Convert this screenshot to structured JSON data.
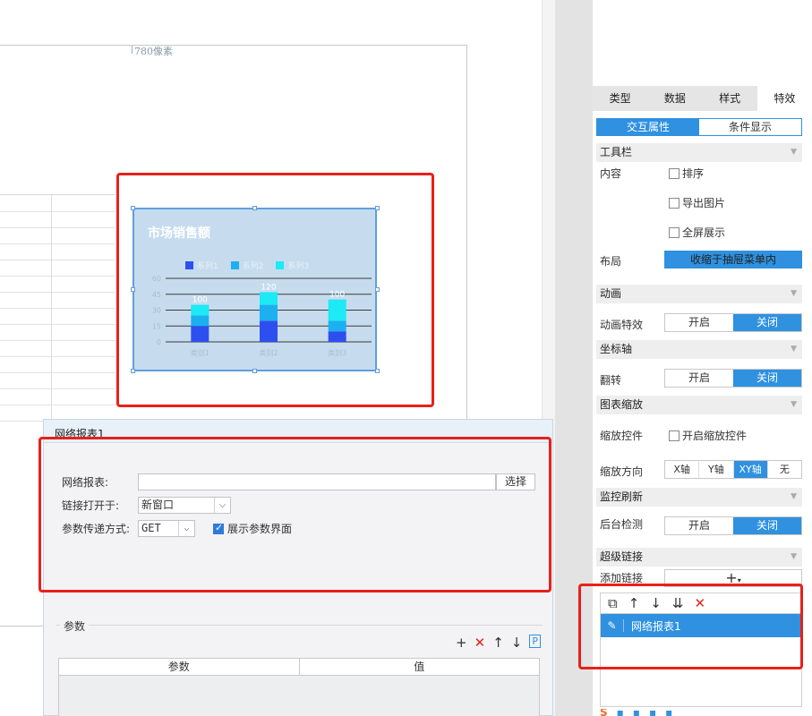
{
  "canvas": {
    "ruler_label": "780像素",
    "chart": {
      "title": "市场销售额",
      "legend": [
        {
          "label": "系列1",
          "color": "#2e4ff0"
        },
        {
          "label": "系列2",
          "color": "#1cb0f0"
        },
        {
          "label": "系列3",
          "color": "#1ceaf5"
        }
      ],
      "bars": [
        {
          "category": "类别1",
          "total_label": "100",
          "stack": [
            15,
            10,
            10
          ]
        },
        {
          "category": "类别2",
          "total_label": "120",
          "stack": [
            20,
            15,
            12
          ]
        },
        {
          "category": "类别3",
          "total_label": "100",
          "stack": [
            10,
            10,
            20
          ]
        }
      ],
      "ylim": [
        0,
        60
      ],
      "y_ticks": [
        "0",
        "15",
        "30",
        "45",
        "60"
      ]
    }
  },
  "dialog": {
    "title": "网络报表1",
    "report_label": "网络报表:",
    "report_value": "",
    "select_button": "选择",
    "open_in_label": "链接打开于:",
    "open_in_value": "新窗口",
    "method_label": "参数传递方式:",
    "method_value": "GET",
    "show_params_label": "展示参数界面",
    "show_params_checked": true,
    "params": {
      "title": "参数",
      "col_param": "参数",
      "col_value": "值"
    }
  },
  "panel": {
    "tabs": [
      "类型",
      "数据",
      "样式",
      "特效"
    ],
    "active_tab": "特效",
    "subtabs": [
      "交互属性",
      "条件显示"
    ],
    "sections": {
      "toolbar": "工具栏",
      "animation": "动画",
      "axis": "坐标轴",
      "zoom": "图表缩放",
      "monitor": "监控刷新",
      "hyperlink": "超级链接"
    },
    "content_label": "内容",
    "content_options": [
      "排序",
      "导出图片",
      "全屏展示"
    ],
    "layout_label": "布局",
    "layout_value": "收缩于抽屉菜单内",
    "anim_label": "动画特效",
    "flip_label": "翻转",
    "zoom_ctrl_label": "缩放控件",
    "zoom_ctrl_option": "开启缩放控件",
    "zoom_dir_label": "缩放方向",
    "zoom_dir_options": [
      "X轴",
      "Y轴",
      "XY轴",
      "无"
    ],
    "backend_label": "后台检测",
    "toggle_on": "开启",
    "toggle_off": "关闭",
    "add_link_label": "添加链接",
    "link_item": "网络报表1"
  }
}
